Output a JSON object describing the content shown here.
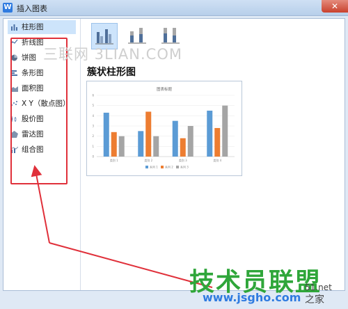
{
  "window": {
    "title": "插入图表",
    "app_icon": "W",
    "close_glyph": "✕"
  },
  "sidebar": {
    "items": [
      {
        "label": "柱形图",
        "icon": "bar-chart-icon",
        "active": true
      },
      {
        "label": "折线图",
        "icon": "line-chart-icon"
      },
      {
        "label": "饼图",
        "icon": "pie-chart-icon"
      },
      {
        "label": "条形图",
        "icon": "horizontal-bar-icon"
      },
      {
        "label": "面积图",
        "icon": "area-chart-icon"
      },
      {
        "label": "X Y（散点图）",
        "icon": "scatter-chart-icon"
      },
      {
        "label": "股价图",
        "icon": "stock-chart-icon"
      },
      {
        "label": "雷达图",
        "icon": "radar-chart-icon"
      },
      {
        "label": "组合图",
        "icon": "combo-chart-icon"
      }
    ]
  },
  "main": {
    "subtypes": [
      {
        "name": "簇状柱形图",
        "icon": "clustered-column-icon",
        "active": true
      },
      {
        "name": "堆积柱形图",
        "icon": "stacked-column-icon"
      },
      {
        "name": "百分比堆积柱形图",
        "icon": "percent-stacked-column-icon"
      }
    ],
    "heading": "簇状柱形图"
  },
  "chart_data": {
    "type": "bar",
    "title": "图表标题",
    "categories": [
      "类别 1",
      "类别 2",
      "类别 3",
      "类别 4"
    ],
    "series": [
      {
        "name": "系列 1",
        "values": [
          4.3,
          2.5,
          3.5,
          4.5
        ]
      },
      {
        "name": "系列 2",
        "values": [
          2.4,
          4.4,
          1.8,
          2.8
        ]
      },
      {
        "name": "系列 3",
        "values": [
          2,
          2,
          3,
          5
        ]
      }
    ],
    "ylim": [
      0,
      6
    ],
    "yticks": [
      "0",
      "1",
      "2",
      "3",
      "4",
      "5",
      "6"
    ],
    "legend_position": "bottom",
    "colors": [
      "#5b9bd5",
      "#ed7d31",
      "#a5a5a5"
    ]
  },
  "watermarks": {
    "top": "三联网 3LIAN.COM",
    "bottom": "技术员联盟",
    "url": "www.jsgho.com",
    "side1": "51.net",
    "side2": "之家"
  },
  "colors": {
    "highlight": "#cde4fb",
    "annotation": "#e0303a"
  }
}
